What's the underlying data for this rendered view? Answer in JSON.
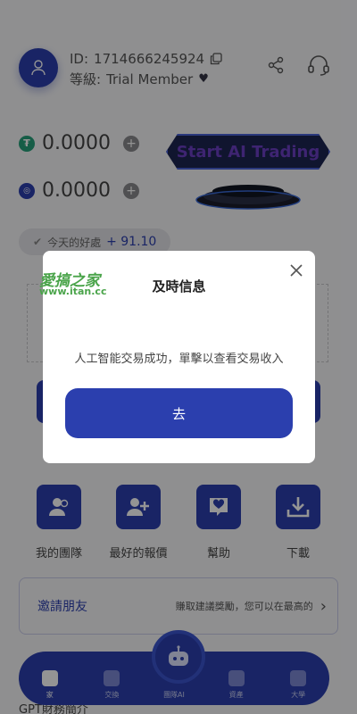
{
  "header": {
    "id_label": "ID:",
    "id_value": "1714666245924",
    "level_label": "等級:",
    "level_value": "Trial Member"
  },
  "balances": [
    {
      "symbol": "₮",
      "value": "0.0000",
      "color": "#26a17b"
    },
    {
      "symbol": "◎",
      "value": "0.0000",
      "color": "#2b3fae"
    }
  ],
  "ai_button": {
    "label": "Start AI Trading"
  },
  "today": {
    "label": "今天的好處",
    "amount": "+ 91.10"
  },
  "shortcuts": [
    {
      "label": "我的團隊",
      "icon": "team-icon"
    },
    {
      "label": "最好的報價",
      "icon": "add-user-icon"
    },
    {
      "label": "幫助",
      "icon": "heart-chat-icon"
    },
    {
      "label": "下載",
      "icon": "download-icon"
    }
  ],
  "invite": {
    "title": "邀請朋友",
    "desc": "賺取建議獎勵，您可以在最高的"
  },
  "bottom_section_title": "GPT財務簡介",
  "tabs": [
    {
      "label": "家",
      "active": true
    },
    {
      "label": "交換",
      "active": false
    },
    {
      "label": "團隊AI",
      "active": false
    },
    {
      "label": "資產",
      "active": false
    },
    {
      "label": "大學",
      "active": false
    }
  ],
  "modal": {
    "title": "及時信息",
    "message": "人工智能交易成功，單擊以查看交易收入",
    "go_label": "去"
  },
  "watermark": {
    "text": "愛搞之家",
    "url": "www.itan.cc"
  },
  "colors": {
    "primary": "#2b3fae",
    "accent_purple": "#6b3fc4"
  }
}
